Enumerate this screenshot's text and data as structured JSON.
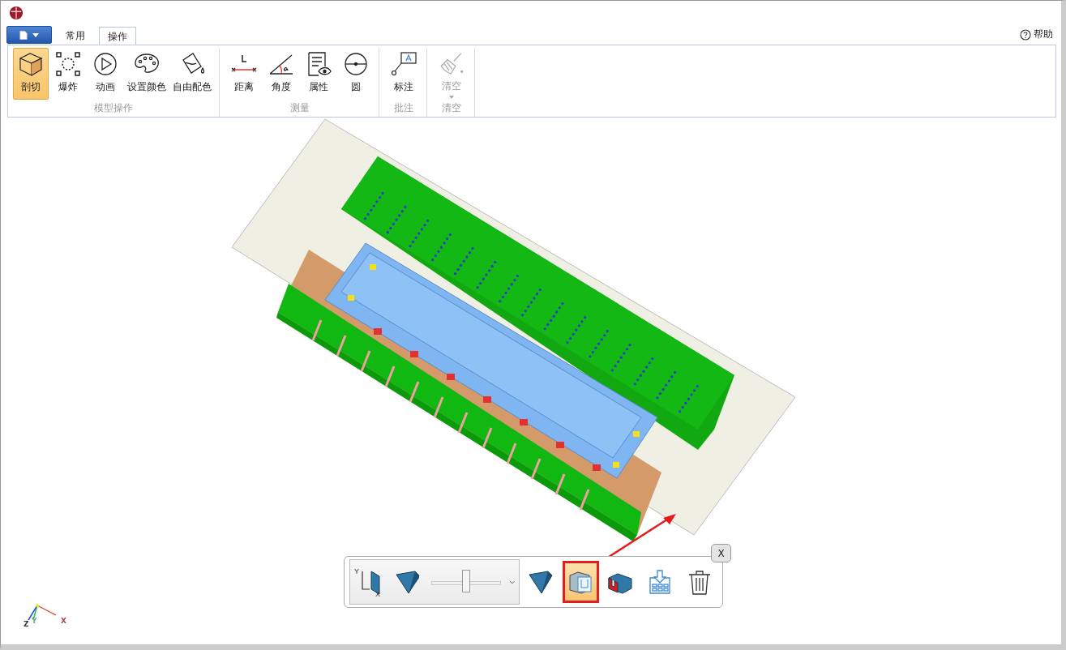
{
  "file_menu": {
    "open": false
  },
  "tabs": [
    {
      "label": "常用",
      "selected": false
    },
    {
      "label": "操作",
      "selected": true
    }
  ],
  "help": {
    "label": "帮助"
  },
  "ribbon_groups": [
    {
      "label": "模型操作",
      "buttons": [
        {
          "kind": "section",
          "label": "剖切",
          "selected": true,
          "disabled": false
        },
        {
          "kind": "explode",
          "label": "爆炸",
          "selected": false,
          "disabled": false
        },
        {
          "kind": "play",
          "label": "动画",
          "selected": false,
          "disabled": false
        },
        {
          "kind": "palette",
          "label": "设置颜色",
          "selected": false,
          "disabled": false
        },
        {
          "kind": "bucket",
          "label": "自由配色",
          "selected": false,
          "disabled": false
        }
      ]
    },
    {
      "label": "测量",
      "buttons": [
        {
          "kind": "distance",
          "label": "距离",
          "selected": false,
          "disabled": false
        },
        {
          "kind": "angle",
          "label": "角度",
          "selected": false,
          "disabled": false
        },
        {
          "kind": "properties",
          "label": "属性",
          "selected": false,
          "disabled": false
        },
        {
          "kind": "circle",
          "label": "圆",
          "selected": false,
          "disabled": false
        }
      ]
    },
    {
      "label": "批注",
      "buttons": [
        {
          "kind": "annotate",
          "label": "标注",
          "selected": false,
          "disabled": false
        }
      ]
    },
    {
      "label": "清空",
      "buttons": [
        {
          "kind": "clear",
          "label": "清空",
          "selected": false,
          "disabled": true
        }
      ]
    }
  ],
  "section_toolbar": {
    "plane_labels": [
      "Y",
      "X"
    ],
    "slider": {
      "level": 0.5
    },
    "tools": [
      {
        "kind": "wedge",
        "selected": false
      },
      {
        "kind": "cutaway",
        "selected": true
      },
      {
        "kind": "cap",
        "selected": false
      },
      {
        "kind": "save",
        "selected": false
      },
      {
        "kind": "delete",
        "selected": false
      }
    ],
    "close": "X"
  },
  "axis_labels": [
    "Z",
    "Y",
    "X"
  ]
}
